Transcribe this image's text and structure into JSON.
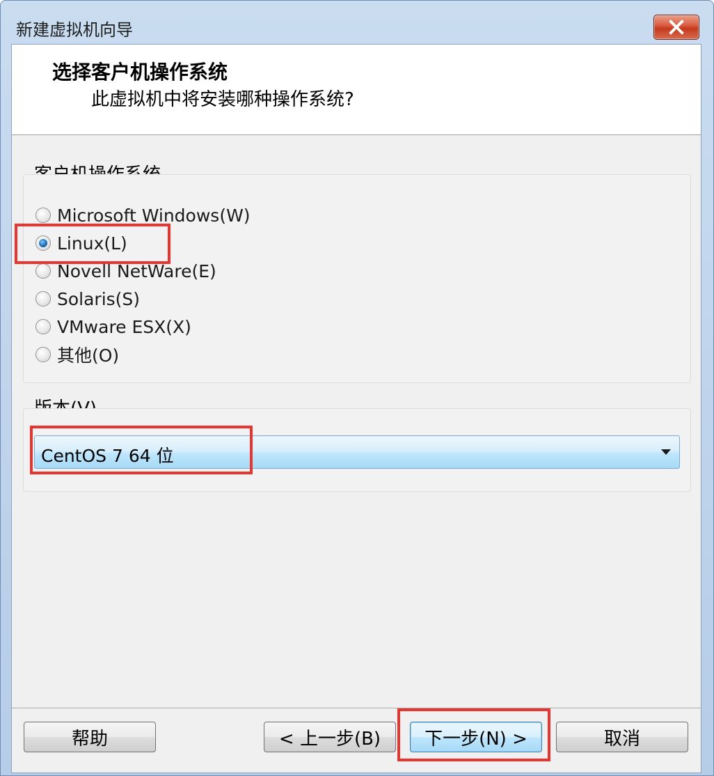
{
  "window": {
    "title": "新建虚拟机向导"
  },
  "header": {
    "title": "选择客户机操作系统",
    "subtitle": "此虚拟机中将安装哪种操作系统?"
  },
  "guest_os": {
    "group_label": "客户机操作系统",
    "options": [
      {
        "label": "Microsoft Windows(W)",
        "selected": false
      },
      {
        "label": "Linux(L)",
        "selected": true
      },
      {
        "label": "Novell NetWare(E)",
        "selected": false
      },
      {
        "label": "Solaris(S)",
        "selected": false
      },
      {
        "label": "VMware ESX(X)",
        "selected": false
      },
      {
        "label": "其他(O)",
        "selected": false
      }
    ]
  },
  "version": {
    "group_label": "版本(V)",
    "selected": "CentOS 7 64 位"
  },
  "buttons": {
    "help": "帮助",
    "back": "< 上一步(B)",
    "next": "下一步(N) >",
    "cancel": "取消"
  },
  "icons": {
    "close": "close-icon",
    "dropdown": "chevron-down-icon"
  },
  "colors": {
    "annotation": "#e8352f",
    "selected_radio": "#1e6fb8"
  }
}
